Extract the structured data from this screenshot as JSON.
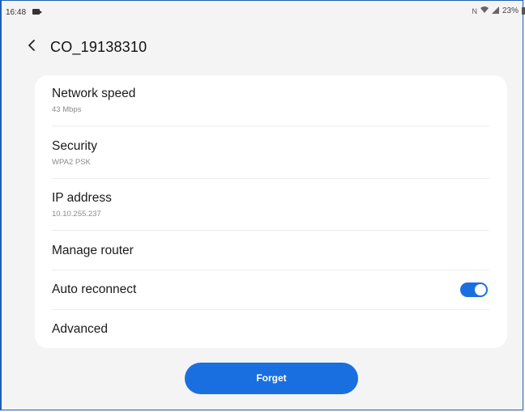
{
  "status_bar": {
    "time": "16:48",
    "battery_text": "23%",
    "icons": [
      "video-recording-icon",
      "nfc-icon",
      "wifi-icon",
      "signal-icon",
      "battery-icon"
    ]
  },
  "header": {
    "title": "CO_19138310",
    "back_icon": "chevron-left-icon"
  },
  "details": {
    "network_speed": {
      "label": "Network speed",
      "value": "43 Mbps"
    },
    "security": {
      "label": "Security",
      "value": "WPA2 PSK"
    },
    "ip_address": {
      "label": "IP address",
      "value": "10.10.255.237"
    },
    "manage_router": {
      "label": "Manage router"
    },
    "auto_reconnect": {
      "label": "Auto reconnect",
      "enabled": true
    },
    "advanced": {
      "label": "Advanced"
    }
  },
  "forget_label": "Forget",
  "colors": {
    "accent": "#1a6fe0",
    "background": "#f4f4f4",
    "card": "#ffffff"
  }
}
